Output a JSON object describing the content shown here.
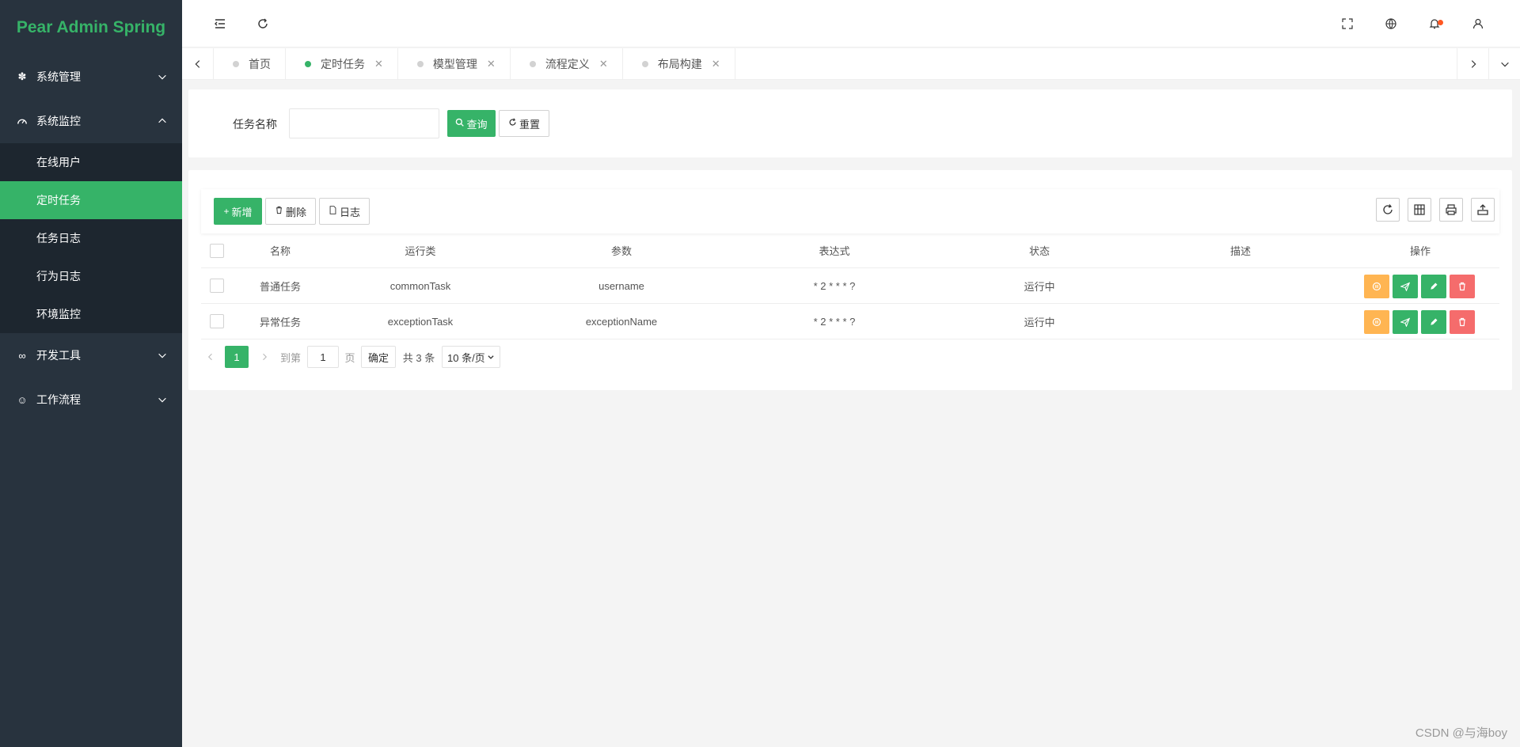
{
  "app": {
    "title": "Pear Admin Spring"
  },
  "colors": {
    "accent": "#36b368",
    "sidebar_bg": "#28333e",
    "submenu_bg": "#1d262f",
    "warn": "#ffb552",
    "danger": "#f56c6c",
    "badge": "#ff5722"
  },
  "sidebar": {
    "items": [
      {
        "label": "系统管理",
        "icon": "gear-icon",
        "expanded": false
      },
      {
        "label": "系统监控",
        "icon": "dashboard-icon",
        "expanded": true,
        "children": [
          {
            "label": "在线用户",
            "active": false
          },
          {
            "label": "定时任务",
            "active": true
          },
          {
            "label": "任务日志",
            "active": false
          },
          {
            "label": "行为日志",
            "active": false
          },
          {
            "label": "环境监控",
            "active": false
          }
        ]
      },
      {
        "label": "开发工具",
        "icon": "link-icon",
        "expanded": false
      },
      {
        "label": "工作流程",
        "icon": "smile-icon",
        "expanded": false
      }
    ]
  },
  "header": {
    "left_icons": [
      "menu-fold-icon",
      "refresh-icon"
    ],
    "right_icons": [
      "fullscreen-icon",
      "globe-icon",
      "bell-icon",
      "user-icon",
      "more-icon"
    ]
  },
  "tabs": [
    {
      "label": "首页",
      "active": false,
      "closable": false
    },
    {
      "label": "定时任务",
      "active": true,
      "closable": true
    },
    {
      "label": "模型管理",
      "active": false,
      "closable": true
    },
    {
      "label": "流程定义",
      "active": false,
      "closable": true
    },
    {
      "label": "布局构建",
      "active": false,
      "closable": true
    }
  ],
  "search": {
    "label": "任务名称",
    "value": "",
    "placeholder": "",
    "query_label": "查询",
    "reset_label": "重置"
  },
  "toolbar": {
    "add_label": "新增",
    "delete_label": "删除",
    "log_label": "日志",
    "right_icons": [
      "refresh-icon",
      "columns-icon",
      "print-icon",
      "export-icon"
    ]
  },
  "table": {
    "columns": [
      "名称",
      "运行类",
      "参数",
      "表达式",
      "状态",
      "描述",
      "操作"
    ],
    "rows": [
      {
        "name": "普通任务",
        "class": "commonTask",
        "param": "username",
        "expr": "* 2 * * * ?",
        "status": "运行中",
        "desc": ""
      },
      {
        "name": "异常任务",
        "class": "exceptionTask",
        "param": "exceptionName",
        "expr": "* 2 * * * ?",
        "status": "运行中",
        "desc": ""
      }
    ]
  },
  "pagination": {
    "current": "1",
    "goto_prefix": "到第",
    "goto_value": "1",
    "goto_suffix": "页",
    "confirm": "确定",
    "total": "共 3 条",
    "page_size": "10 条/页"
  },
  "watermark": "CSDN @与海boy"
}
